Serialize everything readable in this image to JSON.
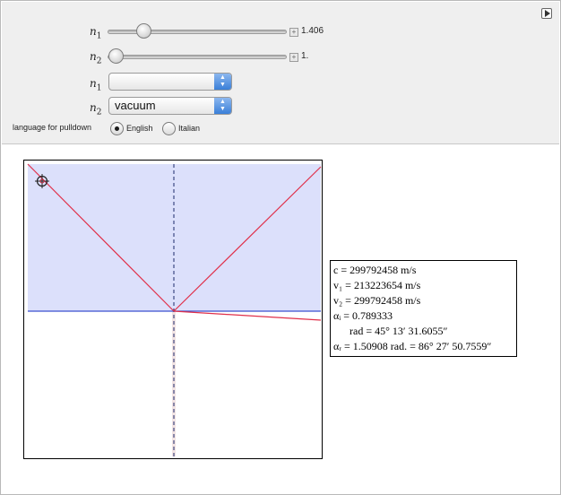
{
  "controls": {
    "n1": {
      "name": "n",
      "sub": "1",
      "value": "1.406",
      "fraction": 0.17
    },
    "n2": {
      "name": "n",
      "sub": "2",
      "value": "1.",
      "fraction": 0.0
    },
    "pulldown_n1": {
      "name": "n",
      "sub": "1",
      "selected": ""
    },
    "pulldown_n2": {
      "name": "n",
      "sub": "2",
      "selected": "vacuum"
    },
    "language": {
      "label": "language for pulldown",
      "options": [
        "English",
        "Italian"
      ],
      "selected": "English"
    }
  },
  "plot": {
    "upper_fill": "#dce0fb",
    "interface_color": "#3b4fcf",
    "ray_color": "#e0304a",
    "normal_color": "#1d2a6b"
  },
  "info": {
    "c": "c = 299792458 m/s",
    "v1": "v₁ = 213223654 m/s",
    "v2": "v₂ = 299792458 m/s",
    "alpha_i": "αᵢ = 0.789333",
    "alpha_i_dms": "rad = 45° 13′ 31.6055″",
    "alpha_r": "αᵣ = 1.50908 rad. = 86° 27′ 50.7559″"
  }
}
